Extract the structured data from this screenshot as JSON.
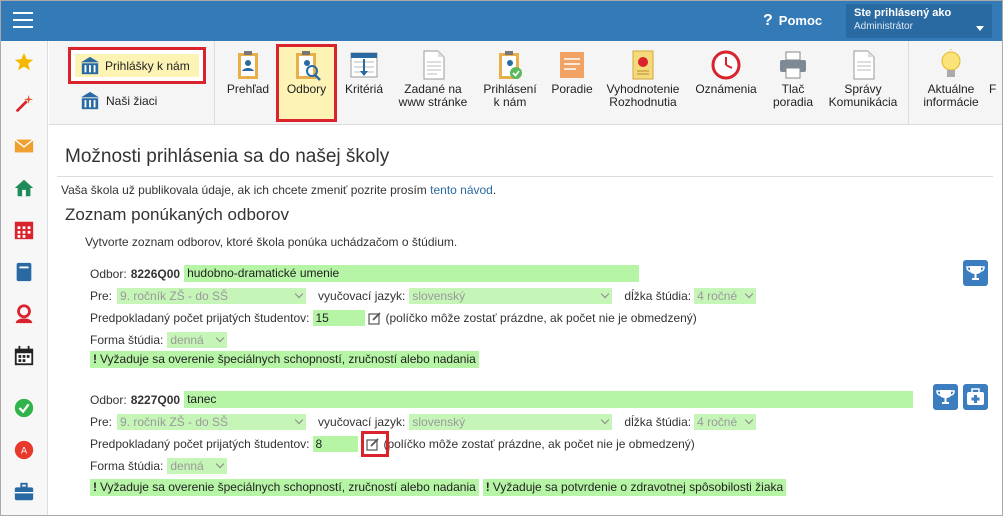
{
  "topbar": {
    "help_label": "Pomoc",
    "user_line1": "Ste prihlásený ako",
    "user_line2": "Administrátor"
  },
  "sidebar": {
    "icons": [
      "star-icon",
      "magic-wand-icon",
      "envelope-icon",
      "home-icon",
      "calendar-grid-icon",
      "book-icon",
      "user-circle-icon",
      "calendar-icon",
      "check-circle-icon",
      "no-entry-icon",
      "briefcase-icon"
    ]
  },
  "toolbar": {
    "left_buttons": [
      {
        "label": "Prihlášky k nám"
      },
      {
        "label": "Naši žiaci"
      }
    ],
    "tools": [
      {
        "label": "Prehľad"
      },
      {
        "label": "Odbory"
      },
      {
        "label": "Kritériá"
      },
      {
        "label1": "Zadané na",
        "label2": "www stránke"
      },
      {
        "label1": "Prihlásení",
        "label2": "k nám"
      },
      {
        "label": "Poradie"
      },
      {
        "label1": "Vyhodnotenie",
        "label2": "Rozhodnutia"
      },
      {
        "label": "Oznámenia"
      },
      {
        "label1": "Tlač",
        "label2": "poradia"
      },
      {
        "label1": "Správy",
        "label2": "Komunikácia"
      },
      {
        "label1": "Aktuálne",
        "label2": "informácie"
      },
      {
        "label": "F"
      }
    ]
  },
  "main": {
    "title": "Možnosti prihlásenia sa do našej školy",
    "intro_text": "Vaša škola už publikovala údaje, ak ich chcete zmeniť pozrite prosím ",
    "intro_link": "tento návod",
    "intro_end": ".",
    "list_title": "Zoznam ponúkaných odborov",
    "list_desc": "Vytvorte zoznam odborov, ktoré škola ponúka uchádzačom o štúdium.",
    "labels": {
      "odbor": "Odbor:",
      "pre": "Pre:",
      "jazyk": "vyučovací jazyk:",
      "dlzka": "dĺžka štúdia:",
      "pocet": "Predpokladaný počet prijatých študentov:",
      "pocet_note": "(políčko môže zostať prázdne, ak počet nie je obmedzený)",
      "forma": "Forma štúdia:"
    },
    "odbory": [
      {
        "code": "8226Q00",
        "name": "hudobno-dramatické umenie",
        "pre": "9. ročník ZŠ - do SŠ",
        "jazyk": "slovenský",
        "dlzka": "4 ročné",
        "pocet": "15",
        "forma": "denná",
        "requirements": [
          "Vyžaduje sa overenie špeciálnych schopností, zručností alebo nadania"
        ]
      },
      {
        "code": "8227Q00",
        "name": "tanec",
        "pre": "9. ročník ZŠ - do SŠ",
        "jazyk": "slovenský",
        "dlzka": "4 ročné",
        "pocet": "8",
        "forma": "denná",
        "requirements": [
          "Vyžaduje sa overenie špeciálnych schopností, zručností alebo nadania",
          "Vyžaduje sa potvrdenie o zdravotnej spôsobilosti žiaka"
        ]
      }
    ]
  },
  "colors": {
    "topbar": "#337ab7",
    "highlight_green": "#b6f5a5",
    "selected_yellow": "#fdf3b5",
    "annotation_red": "#d9232d"
  }
}
